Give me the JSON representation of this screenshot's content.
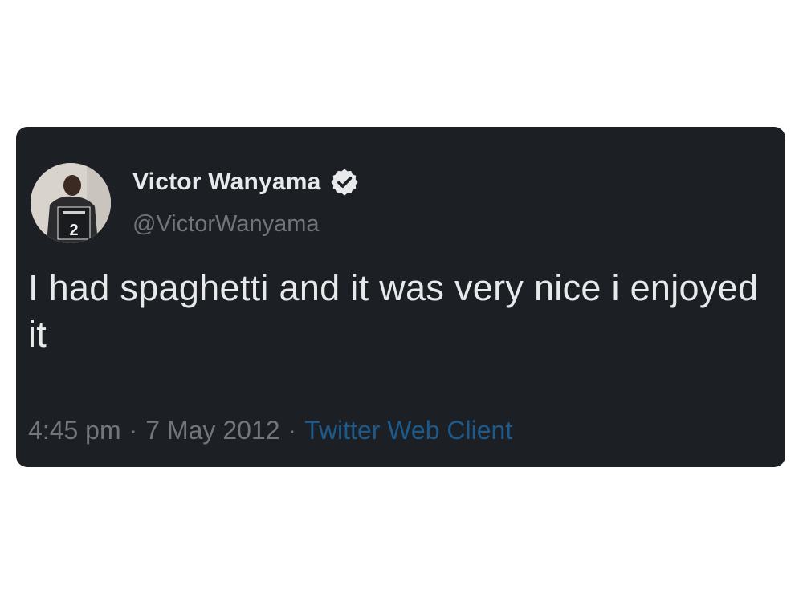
{
  "tweet": {
    "author": {
      "display_name": "Victor Wanyama",
      "handle": "@VictorWanyama",
      "verified": true,
      "avatar_icon": "profile-photo",
      "avatar_jersey_number": "2"
    },
    "text": "I had spaghetti and it was very nice i enjoyed it",
    "time": "4:45 pm",
    "separator": "·",
    "date": "7 May 2012",
    "client": "Twitter Web Client"
  },
  "colors": {
    "card_background": "#1c1f24",
    "primary_text": "#e7e9ea",
    "secondary_text": "#71767b",
    "client_link": "#1d5a8c",
    "verified_badge": "#e7e9ea"
  }
}
